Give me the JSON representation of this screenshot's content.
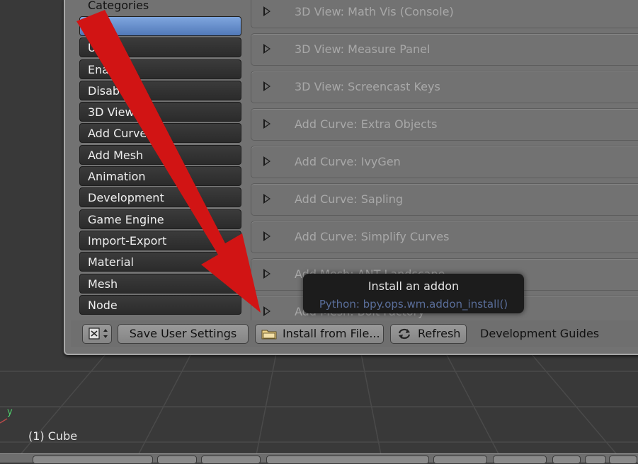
{
  "viewport": {
    "object_label": "(1) Cube",
    "axis_label": "y"
  },
  "categories": {
    "title": "Categories",
    "items": [
      {
        "label": "",
        "selected": true
      },
      {
        "label": "U",
        "selected": false
      },
      {
        "label": "Enab ed",
        "selected": false
      },
      {
        "label": "Disab",
        "selected": false
      },
      {
        "label": "3D View",
        "selected": false
      },
      {
        "label": "Add Curve",
        "selected": false
      },
      {
        "label": "Add Mesh",
        "selected": false
      },
      {
        "label": "Animation",
        "selected": false
      },
      {
        "label": "Development",
        "selected": false
      },
      {
        "label": "Game Engine",
        "selected": false
      },
      {
        "label": "Import-Export",
        "selected": false
      },
      {
        "label": "Material",
        "selected": false
      },
      {
        "label": "Mesh",
        "selected": false
      },
      {
        "label": "Node",
        "selected": false
      }
    ]
  },
  "addons": [
    {
      "label": "3D View: Math Vis (Console)"
    },
    {
      "label": "3D View: Measure Panel"
    },
    {
      "label": "3D View: Screencast Keys"
    },
    {
      "label": "Add Curve: Extra Objects"
    },
    {
      "label": "Add Curve: IvyGen"
    },
    {
      "label": "Add Curve: Sapling"
    },
    {
      "label": "Add Curve: Simplify Curves"
    },
    {
      "label": "Add Mesh: ANT Landscape"
    },
    {
      "label": "Add Mesh: Bolt Factory"
    }
  ],
  "footer": {
    "editor_icon": "preferences-editor-icon",
    "save_label": "Save User Settings",
    "install_label": "Install from File...",
    "refresh_label": "Refresh",
    "dev_guides_label": "Development Guides"
  },
  "tooltip": {
    "title": "Install an addon",
    "python": "Python: bpy.ops.wm.addon_install()"
  },
  "colors": {
    "arrow": "#d11414",
    "selected_category": "#6a90cf"
  }
}
